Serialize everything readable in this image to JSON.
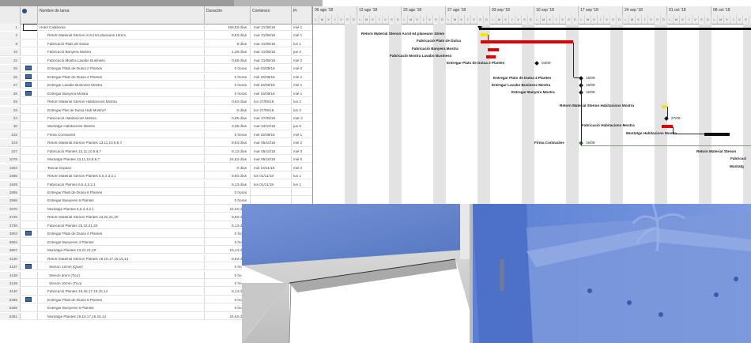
{
  "columns": {
    "indicators": "",
    "name": "Nombre de tarea",
    "duration": "Duración",
    "start": "Comienzo",
    "pred": "Pr"
  },
  "tasks": [
    {
      "id": "1",
      "name": "Hotel Calabonia",
      "dur": "168,83 días",
      "start": "mar 21/08/18",
      "pred": "mié 1",
      "sel": true
    },
    {
      "id": "2",
      "name": "Retorn Material Stenon Acrol 64 planeans 10mm",
      "dur": "8,83 días",
      "start": "mar 21/08/18",
      "pred": "mié 1"
    },
    {
      "id": "8",
      "name": "Fabricació Plats de Dutxa",
      "dur": "8 días",
      "start": "mar 21/08/18",
      "pred": "lun 1"
    },
    {
      "id": "15",
      "name": "Fabricació Banyera Mostra",
      "dur": "1,38 días",
      "start": "mar 21/08/18",
      "pred": "jue 2"
    },
    {
      "id": "22",
      "name": "Fabricació Mostra Lavabo Business",
      "dur": "0,88 días",
      "start": "mar 21/08/18",
      "pred": "mié 2"
    },
    {
      "id": "25",
      "name": "Entregar Plats de Dutxa 2 Plantes",
      "dur": "0 horas",
      "start": "mié 03/09/18",
      "pred": "mié 0",
      "icon": true
    },
    {
      "id": "26",
      "name": "Entregar Plats de Dutxa 4 Plantes",
      "dur": "0 horas",
      "start": "mié 15/09/18",
      "pred": "mié 1",
      "icon": true
    },
    {
      "id": "27",
      "name": "Entregar Lavabo Business Mostra",
      "dur": "0 horas",
      "start": "mié 15/09/18",
      "pred": "mié 1",
      "icon": true
    },
    {
      "id": "28",
      "name": "Entregar Banyera Mostra",
      "dur": "0 horas",
      "start": "mié 15/09/18",
      "pred": "mié 1",
      "icon": true
    },
    {
      "id": "29",
      "name": "Retorn Material Stenon Habitacions Mostra",
      "dur": "0,63 días",
      "start": "lun 27/09/18",
      "pred": "lun 2"
    },
    {
      "id": "33",
      "name": "Entregar Plat de Dutxa Hab Mostra?",
      "dur": "0 días",
      "start": "lun 27/09/18",
      "pred": "lun 2"
    },
    {
      "id": "34",
      "name": "Fabricació Habitacions Mostra",
      "dur": "0,88 días",
      "start": "mar 27/09/18",
      "pred": "mar 2"
    },
    {
      "id": "40",
      "name": "Muntatge Habitacions Mostra",
      "dur": "3,38 días",
      "start": "mar 04/10/18",
      "pred": "jue 0"
    },
    {
      "id": "102",
      "name": "Firma Contractes",
      "dur": "0 horas",
      "start": "mié 15/09/18",
      "pred": "mié 1"
    },
    {
      "id": "103",
      "name": "Retorn Material Stenon Plantes 13,11,10,9,8,7",
      "dur": "8,83 días",
      "start": "mar 05/10/18",
      "pred": "mié 2"
    },
    {
      "id": "107",
      "name": "Fabricació Plantes 13,11,10,9,8,7",
      "dur": "8,13 días",
      "start": "mar 05/10/18",
      "pred": "mié 0"
    },
    {
      "id": "1076",
      "name": "Muntatge Plantes 13,11,10,9,8,7",
      "dur": "24,63 días",
      "start": "mar 05/10/18",
      "pred": "mié 0"
    },
    {
      "id": "1664",
      "name": "Tancar Expanx",
      "dur": "0 días",
      "start": "mié 24/11/18",
      "pred": "mié 2"
    },
    {
      "id": "1665",
      "name": "Retorn Material Stenon Plantes 6,5,4,3,2,1",
      "dur": "8,83 días",
      "start": "lun 01/11/18",
      "pred": "lun 1"
    },
    {
      "id": "1849",
      "name": "Fabricació Plantes 6,5,4,3,2,1",
      "dur": "8,13 días",
      "start": "lun 01/11/18",
      "pred": "lun 1"
    },
    {
      "id": "2865",
      "name": "Entregar Plats de Dutxa 6 Plantes",
      "dur": "0 horas",
      "start": "",
      "pred": ""
    },
    {
      "id": "2866",
      "name": "Entregar Banyeres 6 Plantes",
      "dur": "0 horas",
      "start": "",
      "pred": ""
    },
    {
      "id": "2870",
      "name": "Muntatge Plantes 6,5,4,3,2,1",
      "dur": "24,63 días",
      "start": "",
      "pred": ""
    },
    {
      "id": "3726",
      "name": "Retorn Material Stenon Plantes 23,22,21,20",
      "dur": "8,83 días",
      "start": "",
      "pred": ""
    },
    {
      "id": "3730",
      "name": "Fabricació Plantes 23,22,21,20",
      "dur": "8,13 días",
      "start": "",
      "pred": ""
    },
    {
      "id": "3803",
      "name": "Entregar Plats de Dutxa 4 Plantes",
      "dur": "0 horas",
      "start": "",
      "pred": "",
      "icon": true
    },
    {
      "id": "3804",
      "name": "Entregar Banyeres 4 Plantes",
      "dur": "0 horas",
      "start": "",
      "pred": ""
    },
    {
      "id": "3807",
      "name": "Muntatge Plantes 23,22,21,20",
      "dur": "16,13 días",
      "start": "",
      "pred": ""
    },
    {
      "id": "4130",
      "name": "Retorn Material Stenon Plantes 19,18,17,16,15,14",
      "dur": "8,83 días",
      "start": "",
      "pred": ""
    },
    {
      "id": "4137",
      "name": "Stenon 12mm (Quie)",
      "dur": "0 horas",
      "start": "",
      "pred": "",
      "icon": true,
      "indent": 2
    },
    {
      "id": "4138",
      "name": "Stenon 6mm (Tico)",
      "dur": "0 horas",
      "start": "",
      "pred": "",
      "indent": 2
    },
    {
      "id": "4139",
      "name": "Stenon 10mm (Tico)",
      "dur": "0 horas",
      "start": "",
      "pred": "",
      "indent": 2
    },
    {
      "id": "4140",
      "name": "Fabricació Plantes 19,18,17,16,15,14",
      "dur": "8,13 días",
      "start": "",
      "pred": ""
    },
    {
      "id": "5368",
      "name": "Entregar Plats de Dutxa 6 Plantes",
      "dur": "0 horas",
      "start": "",
      "pred": "",
      "icon": true
    },
    {
      "id": "5369",
      "name": "Entregar Banyeres 6 Plantes",
      "dur": "0 horas",
      "start": "",
      "pred": ""
    },
    {
      "id": "5361",
      "name": "Muntatge Plantes 19,18,17,16,15,14",
      "dur": "24,63 días",
      "start": "",
      "pred": ""
    }
  ],
  "gantt": {
    "weeks": [
      "06 ago '18",
      "13 ago '18",
      "20 ago '18",
      "27 ago '18",
      "03 sep '18",
      "10 sep '18",
      "17 sep '18",
      "24 sep '18",
      "01 oct '18",
      "08 oct '18"
    ],
    "day_letters": [
      "L",
      "M",
      "X",
      "J",
      "V",
      "S",
      "D"
    ],
    "bar_labels": {
      "b1": "Retorn Material Stenon Acrol 64 planeans 10mm",
      "b2": "Fabricació Plats de Dutxa",
      "b3": "Fabricació Banyera Mostra",
      "b4": "Fabricació Mostra Lavabo Business",
      "m1": "Entregar Plats de Dutxa 2 Plantes",
      "m2": "Entregar Plats de Dutxa 4 Plantes",
      "m3": "Entregar Lavabo Business Mostra",
      "m4": "Entregar Banyera Mostra",
      "b5": "Retorn Material Stenon Habitacions Mostra",
      "b6": "Fabricació Habitacions Mostra",
      "b7": "Muntatge Habitacions Mostra",
      "m5": "Firma Contractes",
      "b8": "Retorn Material Stenon",
      "b9": "Fabricaci",
      "b10": "Muntatg"
    },
    "milestone_dates": {
      "m1": "04/09",
      "m2": "15/09",
      "m3": "15/09",
      "m4": "15/09",
      "m5": "15/09",
      "m6": "27/09"
    },
    "colors": {
      "summary": "#111111",
      "yellow": "#f3e600",
      "red": "#e00000",
      "milestone": "#111111",
      "link": "#2a2a2a"
    }
  }
}
